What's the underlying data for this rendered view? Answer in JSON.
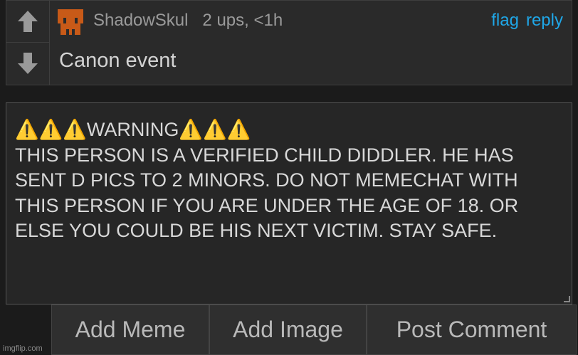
{
  "comment": {
    "username": "ShadowSkul",
    "upvotes": "2 ups, <1h",
    "actions": {
      "flag": "flag",
      "reply": "reply"
    },
    "text": "Canon event",
    "icons": {
      "upvote": "arrow-up-icon",
      "downvote": "arrow-down-icon",
      "avatar": "pixel-avatar"
    },
    "colors": {
      "link": "#1fa7e8",
      "avatar": "#c85a18"
    }
  },
  "compose": {
    "text": "⚠️⚠️⚠️WARNING⚠️⚠️⚠️\nTHIS PERSON IS A VERIFIED CHILD DIDDLER. HE HAS SENT D PICS TO 2 MINORS. DO NOT MEMECHAT WITH THIS PERSON IF YOU ARE UNDER THE AGE OF 18. OR ELSE YOU COULD BE HIS NEXT VICTIM. STAY SAFE."
  },
  "buttons": {
    "add_meme": "Add Meme",
    "add_image": "Add Image",
    "post_comment": "Post Comment"
  },
  "watermark": "imgflip.com"
}
